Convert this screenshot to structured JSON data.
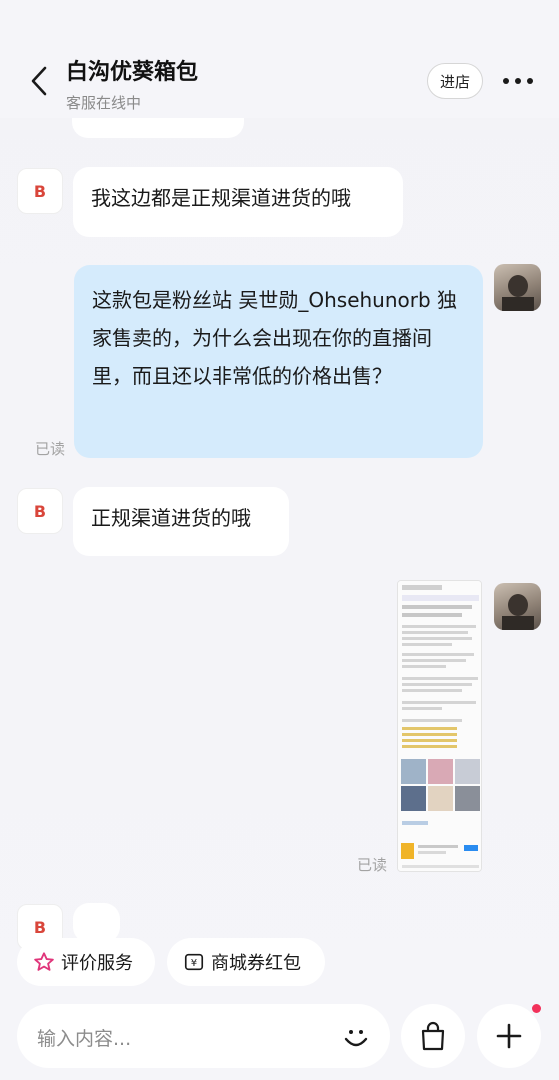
{
  "header": {
    "title": "白沟优葵箱包",
    "status": "客服在线中",
    "store_button": "进店"
  },
  "messages": [
    {
      "from": "shop",
      "avatar_letter": "B",
      "text": "我这边都是正规渠道进货的哦"
    },
    {
      "from": "user",
      "text": "这款包是粉丝站 吴世勋_Ohsehunorb 独家售卖的，为什么会出现在你的直播间里，而且还以非常低的价格出售？",
      "read_label": "已读"
    },
    {
      "from": "shop",
      "avatar_letter": "B",
      "text": "正规渠道进货的哦"
    },
    {
      "from": "user",
      "type": "image",
      "read_label": "已读"
    },
    {
      "from": "shop",
      "avatar_letter": "B"
    }
  ],
  "quick_actions": [
    {
      "label": "评价服务",
      "icon": "star-icon"
    },
    {
      "label": "商城券红包",
      "icon": "coupon-icon"
    }
  ],
  "input": {
    "placeholder": "输入内容..."
  },
  "colors": {
    "shop_accent": "#d9463b",
    "out_bubble": "#d5ebfc",
    "star_pink": "#e0357a",
    "notification_dot": "#f2315a"
  }
}
